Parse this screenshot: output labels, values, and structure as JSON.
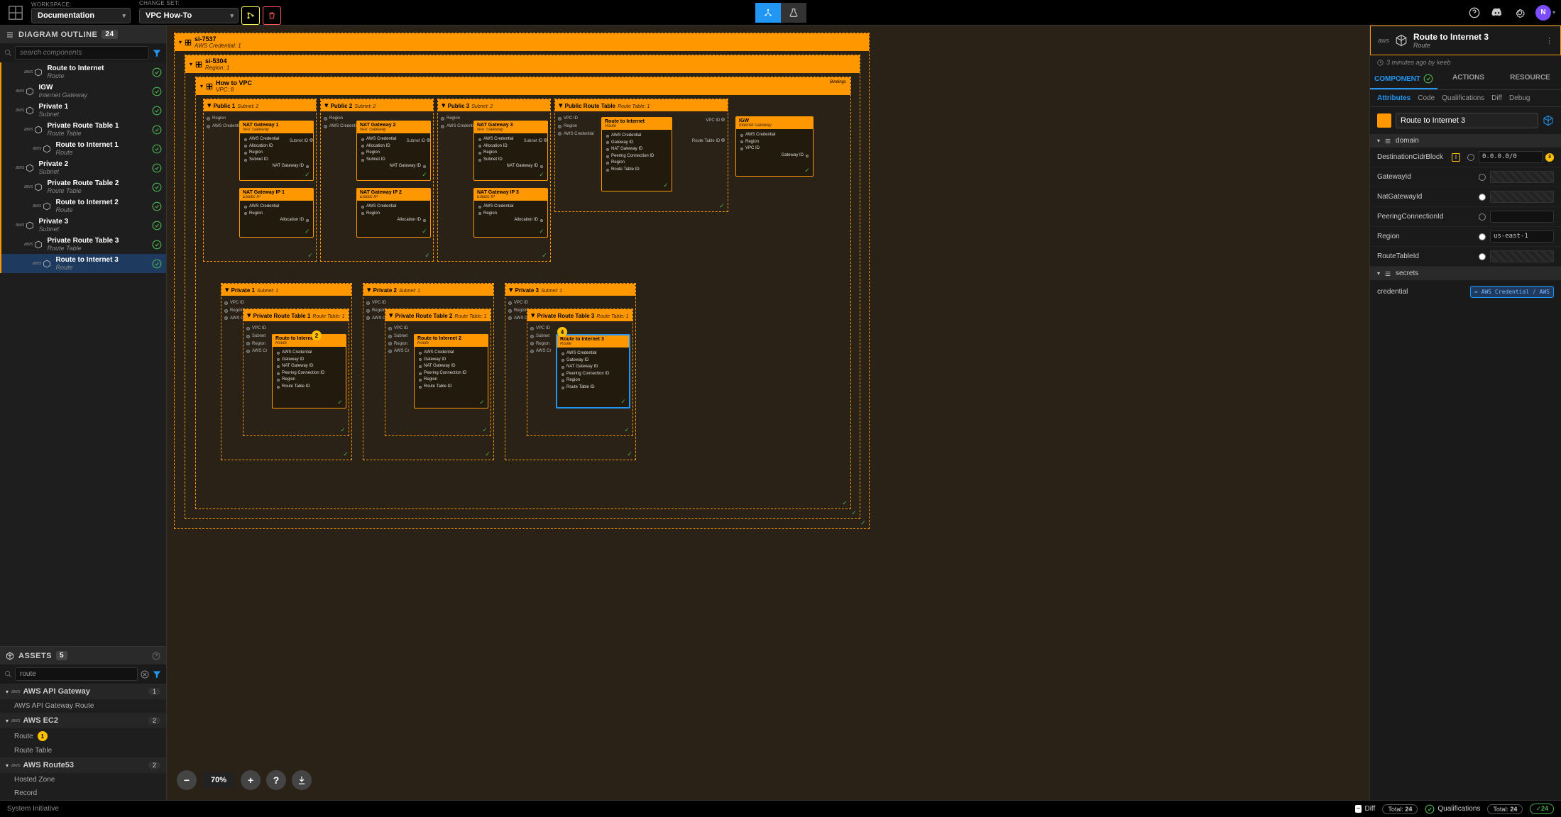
{
  "topbar": {
    "workspace_label": "WORKSPACE:",
    "workspace_value": "Documentation",
    "changeset_label": "CHANGE SET:",
    "changeset_value": "VPC How-To"
  },
  "avatar_letter": "N",
  "diagram_outline": {
    "title": "DIAGRAM OUTLINE",
    "count": "24",
    "search_placeholder": "search components",
    "items": [
      {
        "title": "Route to Internet",
        "subtitle": "Route",
        "indent": 2,
        "stripe": true
      },
      {
        "title": "IGW",
        "subtitle": "Internet Gateway",
        "indent": 1,
        "stripe": true
      },
      {
        "title": "Private 1",
        "subtitle": "Subnet",
        "indent": 1,
        "stripe": true
      },
      {
        "title": "Private Route Table 1",
        "subtitle": "Route Table",
        "indent": 2,
        "stripe": true
      },
      {
        "title": "Route to Internet 1",
        "subtitle": "Route",
        "indent": 3,
        "stripe": true
      },
      {
        "title": "Private 2",
        "subtitle": "Subnet",
        "indent": 1,
        "stripe": true
      },
      {
        "title": "Private Route Table 2",
        "subtitle": "Route Table",
        "indent": 2,
        "stripe": true
      },
      {
        "title": "Route to Internet 2",
        "subtitle": "Route",
        "indent": 3,
        "stripe": true
      },
      {
        "title": "Private 3",
        "subtitle": "Subnet",
        "indent": 1,
        "stripe": true
      },
      {
        "title": "Private Route Table 3",
        "subtitle": "Route Table",
        "indent": 2,
        "stripe": true
      },
      {
        "title": "Route to Internet 3",
        "subtitle": "Route",
        "indent": 3,
        "stripe": true,
        "active": true
      }
    ]
  },
  "assets": {
    "title": "ASSETS",
    "count": "5",
    "search_value": "route",
    "groups": [
      {
        "title": "AWS API Gateway",
        "count": "1",
        "items": [
          "AWS API Gateway Route"
        ]
      },
      {
        "title": "AWS EC2",
        "count": "2",
        "items_badge": [
          {
            "t": "Route",
            "b": "1"
          },
          {
            "t": "Route Table",
            "b": null
          }
        ]
      },
      {
        "title": "AWS Route53",
        "count": "2",
        "items": [
          "Hosted Zone",
          "Record"
        ]
      }
    ]
  },
  "canvas": {
    "zoom": "70%",
    "top_frame": {
      "title": "si-7537",
      "subtitle": "AWS Credential: 1"
    },
    "region_frame": {
      "title": "si-5304",
      "subtitle": "Region: 1"
    },
    "vpc_frame": {
      "title": "How to VPC",
      "subtitle": "VPC: 8"
    },
    "public_subnets": [
      {
        "title": "Public 1",
        "subtitle": "Subnet: 2"
      },
      {
        "title": "Public 2",
        "subtitle": "Subnet: 2"
      },
      {
        "title": "Public 3",
        "subtitle": "Subnet: 2"
      }
    ],
    "public_rt": {
      "title": "Public Route Table",
      "subtitle": "Route Table: 1"
    },
    "nat_gateways": [
      {
        "title": "NAT Gateway 1",
        "subtitle": "NAT Gateway"
      },
      {
        "title": "NAT Gateway 2",
        "subtitle": "NAT Gateway"
      },
      {
        "title": "NAT Gateway 3",
        "subtitle": "NAT Gateway"
      }
    ],
    "nat_ips": [
      {
        "title": "NAT Gateway IP 1",
        "subtitle": "Elastic IP"
      },
      {
        "title": "NAT Gateway IP 2",
        "subtitle": "Elastic IP"
      },
      {
        "title": "NAT Gateway IP 3",
        "subtitle": "Elastic IP"
      }
    ],
    "route_to_internet": {
      "title": "Route to Internet",
      "subtitle": "Route"
    },
    "igw": {
      "title": "IGW",
      "subtitle": "Internet Gateway"
    },
    "private_subnets": [
      {
        "title": "Private 1",
        "subtitle": "Subnet: 1"
      },
      {
        "title": "Private 2",
        "subtitle": "Subnet: 1"
      },
      {
        "title": "Private 3",
        "subtitle": "Subnet: 1"
      }
    ],
    "private_rts": [
      {
        "title": "Private Route Table 1",
        "subtitle": "Route Table: 1"
      },
      {
        "title": "Private Route Table 2",
        "subtitle": "Route Table: 1"
      },
      {
        "title": "Private Route Table 3",
        "subtitle": "Route Table: 1"
      }
    ],
    "route_internets": [
      {
        "title": "Route to Internet 1",
        "subtitle": "Route"
      },
      {
        "title": "Route to Internet 2",
        "subtitle": "Route"
      },
      {
        "title": "Route to Internet 3",
        "subtitle": "Route"
      }
    ],
    "nat_props": [
      "AWS Credential",
      "Allocation ID",
      "Region",
      "Subnet ID"
    ],
    "nat_out": "NAT Gateway ID",
    "eip_props": [
      "AWS Credential",
      "Region"
    ],
    "eip_out": "Allocation ID",
    "rti_props": [
      "AWS Credential",
      "Gateway ID",
      "NAT Gateway ID",
      "Peering Connection ID",
      "Region",
      "Route Table ID"
    ],
    "rt_props": [
      "AWS Credential",
      "Region",
      "VPC ID"
    ],
    "rt_out": "Route Table ID",
    "igw_props": [
      "AWS Credential",
      "Region",
      "VPC ID"
    ],
    "igw_out": "Gateway ID",
    "subnet_side_props": [
      "Region",
      "AWS Credential"
    ],
    "subnet_side_right": [
      "VPC ID",
      "Region",
      "AWS"
    ],
    "subnet_out": "Subnet ID",
    "prt_side": [
      "VPC ID",
      "Region",
      "AWS Credential"
    ],
    "private_subnet_side": [
      "VPC ID",
      "Region",
      "AWS Credential"
    ],
    "prt_rti_side": [
      "VPC ID",
      "Subnet",
      "Region",
      "AWS Cr"
    ],
    "pub_rt_side": [
      "VPC ID",
      "Region",
      "AWS Credential"
    ],
    "badge2": "2",
    "badge4": "4",
    "rt_inner_title": "Route Table"
  },
  "right_panel": {
    "title": "Route to Internet 3",
    "subtitle": "Route",
    "timestamp": "3 minutes ago by keeb",
    "main_tabs": [
      "COMPONENT",
      "ACTIONS",
      "RESOURCE"
    ],
    "sub_tabs": [
      "Attributes",
      "Code",
      "Qualifications",
      "Diff",
      "Debug"
    ],
    "name_value": "Route to Internet 3",
    "domain_label": "domain",
    "attributes": [
      {
        "label": "DestinationCidrBlock",
        "value": "0.0.0.0/0",
        "badge": "3"
      },
      {
        "label": "GatewayId",
        "striped": true
      },
      {
        "label": "NatGatewayId",
        "striped": true,
        "filled": true
      },
      {
        "label": "PeeringConnectionId"
      },
      {
        "label": "Region",
        "value": "us-east-1",
        "filled": true
      },
      {
        "label": "RouteTableId",
        "striped": true,
        "filled": true
      }
    ],
    "secrets_label": "secrets",
    "credential_label": "credential",
    "credential_value": "↔ AWS Credential / AWS"
  },
  "statusbar": {
    "brand": "System Initiative",
    "diff_label": "Diff",
    "total_label": "Total:",
    "total_count": "24",
    "qual_label": "Qualifications",
    "qual_total": "24",
    "qual_ok": "24"
  }
}
